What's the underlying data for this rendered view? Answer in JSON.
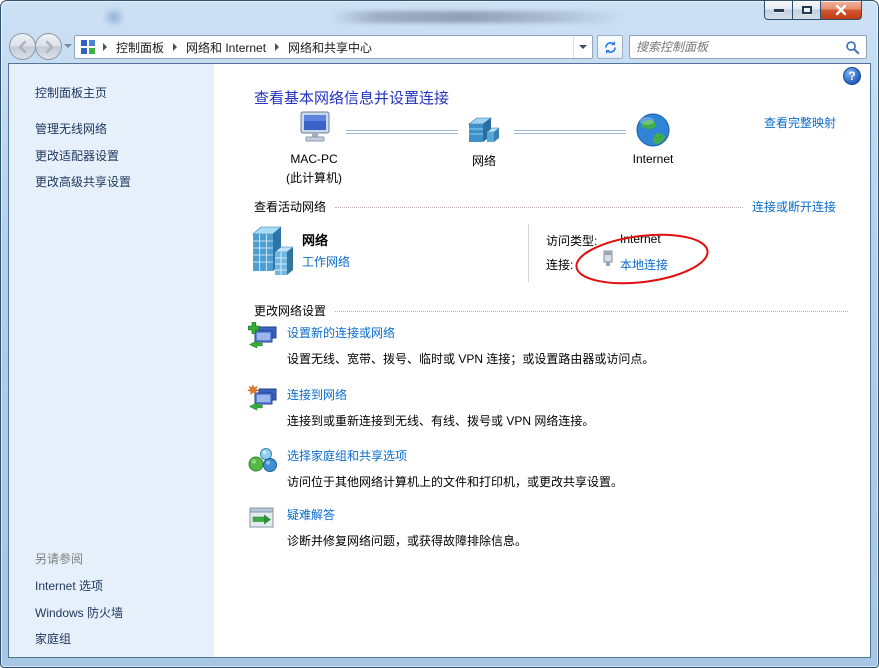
{
  "chrome": {
    "breadcrumb": [
      "控制面板",
      "网络和 Internet",
      "网络和共享中心"
    ],
    "search_placeholder": "搜索控制面板"
  },
  "sidebar": {
    "items": [
      {
        "label": "控制面板主页"
      },
      {
        "label": "管理无线网络"
      },
      {
        "label": "更改适配器设置"
      },
      {
        "label": "更改高级共享设置"
      }
    ],
    "see_also": {
      "header": "另请参阅",
      "items": [
        {
          "label": "Internet 选项"
        },
        {
          "label": "Windows 防火墙"
        },
        {
          "label": "家庭组"
        }
      ]
    }
  },
  "main": {
    "title": "查看基本网络信息并设置连接",
    "network_map": {
      "computer": {
        "label": "MAC-PC",
        "sublabel": "(此计算机)",
        "icon": "computer-icon"
      },
      "network": {
        "label": "网络",
        "icon": "network-node-icon"
      },
      "internet": {
        "label": "Internet",
        "icon": "globe-icon"
      },
      "full_map_link": "查看完整映射"
    },
    "active_networks": {
      "header": "查看活动网络",
      "connect_disconnect_link": "连接或断开连接",
      "network_name": "网络",
      "network_category": "工作网络",
      "access_type_label": "访问类型:",
      "access_type_value": "Internet",
      "connections_label": "连接:",
      "connection_link": "本地连接"
    },
    "settings": {
      "header": "更改网络设置",
      "items": [
        {
          "icon": "new-connection-icon",
          "title": "设置新的连接或网络",
          "desc": "设置无线、宽带、拨号、临时或 VPN 连接；或设置路由器或访问点。"
        },
        {
          "icon": "connect-to-network-icon",
          "title": "连接到网络",
          "desc": "连接到或重新连接到无线、有线、拨号或 VPN 网络连接。"
        },
        {
          "icon": "homegroup-icon",
          "title": "选择家庭组和共享选项",
          "desc": "访问位于其他网络计算机上的文件和打印机，或更改共享设置。"
        },
        {
          "icon": "troubleshoot-icon",
          "title": "疑难解答",
          "desc": "诊断并修复网络问题，或获得故障排除信息。"
        }
      ]
    }
  },
  "colors": {
    "heading_blue": "#2233c0",
    "link_blue": "#0b6ccd",
    "annotation_red": "#de1010"
  }
}
